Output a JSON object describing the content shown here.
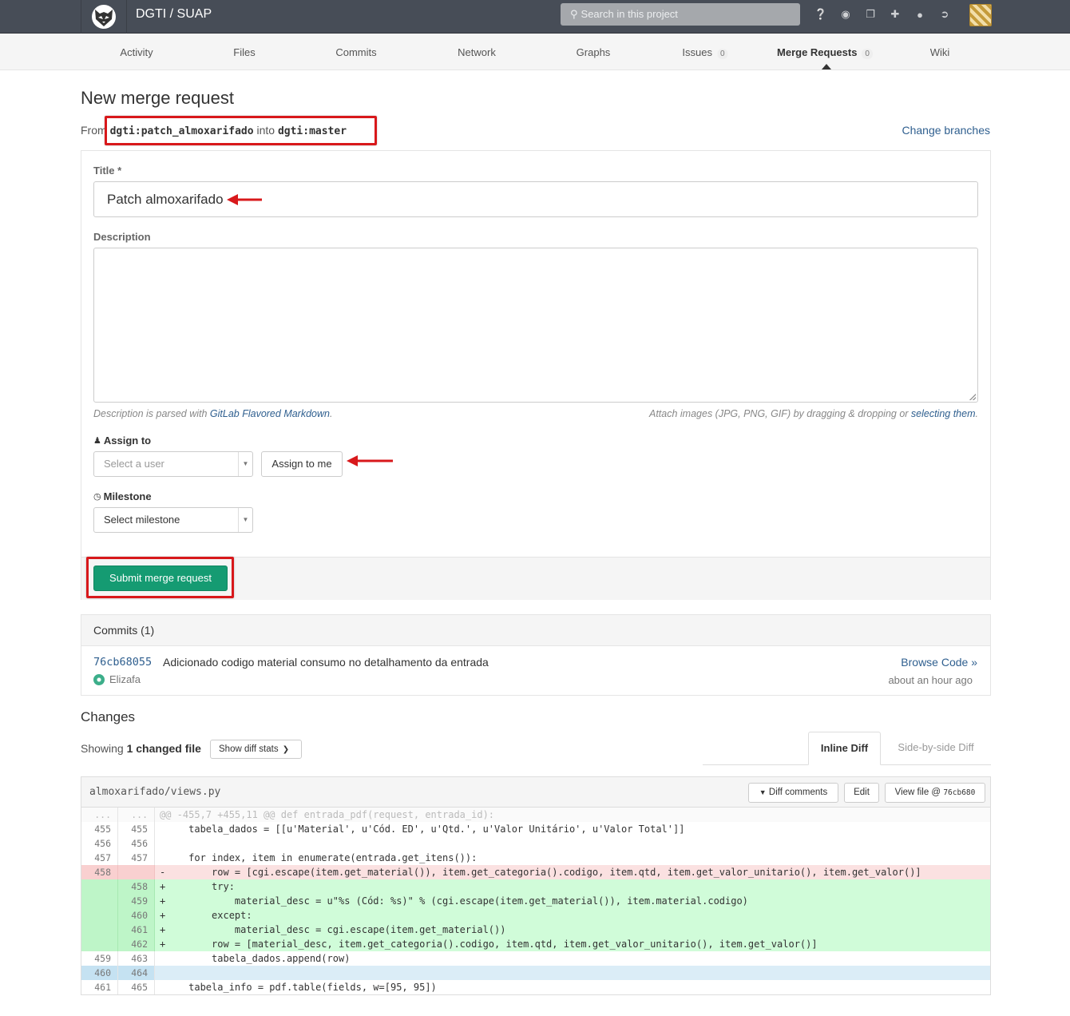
{
  "header": {
    "project_title": "DGTI / SUAP",
    "search_placeholder": "Search in this project",
    "icons": [
      "help-icon",
      "globe-icon",
      "snippets-icon",
      "plus-icon",
      "user-icon",
      "logout-icon"
    ]
  },
  "nav": {
    "tabs": [
      {
        "label": "Activity"
      },
      {
        "label": "Files"
      },
      {
        "label": "Commits"
      },
      {
        "label": "Network"
      },
      {
        "label": "Graphs"
      },
      {
        "label": "Issues",
        "badge": "0"
      },
      {
        "label": "Merge Requests",
        "badge": "0",
        "active": true
      },
      {
        "label": "Wiki"
      }
    ]
  },
  "page": {
    "title": "New merge request",
    "from_prefix": "From",
    "source_branch": "dgti:patch_almoxarifado",
    "into_word": "into",
    "target_branch": "dgti:master",
    "change_branches": "Change branches"
  },
  "form": {
    "title_label": "Title *",
    "title_value": "Patch almoxarifado",
    "description_label": "Description",
    "description_value": "",
    "hint_left_prefix": "Description is parsed with ",
    "hint_left_link": "GitLab Flavored Markdown",
    "hint_left_suffix": ".",
    "hint_right_prefix": "Attach images (JPG, PNG, GIF) by dragging & dropping or ",
    "hint_right_link": "selecting them",
    "hint_right_suffix": ".",
    "assign_label": "Assign to",
    "assign_placeholder": "Select a user",
    "assign_me": "Assign to me",
    "milestone_label": "Milestone",
    "milestone_placeholder": "Select milestone",
    "submit": "Submit merge request"
  },
  "commits": {
    "heading": "Commits (1)",
    "items": [
      {
        "sha": "76cb68055",
        "message": "Adicionado codigo material consumo no detalhamento da entrada",
        "author": "Elizafa",
        "browse": "Browse Code »",
        "time": "about an hour ago"
      }
    ]
  },
  "changes": {
    "heading": "Changes",
    "showing_prefix": "Showing ",
    "showing_count": "1 changed file",
    "diff_stats": "Show diff stats",
    "tab_inline": "Inline Diff",
    "tab_side": "Side-by-side Diff",
    "file": {
      "path": "almoxarifado/views.py",
      "diff_comments": "Diff comments",
      "edit": "Edit",
      "view_file": "View file @ ",
      "view_sha": "76cb680",
      "lines": [
        {
          "type": "hunk",
          "old": "...",
          "new": "...",
          "code": "@@ -455,7 +455,11 @@ def entrada_pdf(request, entrada_id):"
        },
        {
          "type": "ctx",
          "old": "455",
          "new": "455",
          "code": "     tabela_dados = [[u'Material', u'Cód. ED', u'Qtd.', u'Valor Unitário', u'Valor Total']]"
        },
        {
          "type": "ctx",
          "old": "456",
          "new": "456",
          "code": " "
        },
        {
          "type": "ctx",
          "old": "457",
          "new": "457",
          "code": "     for index, item in enumerate(entrada.get_itens()):"
        },
        {
          "type": "del",
          "old": "458",
          "new": "",
          "code": "-        row = [cgi.escape(item.get_material()), item.get_categoria().codigo, item.qtd, item.get_valor_unitario(), item.get_valor()]"
        },
        {
          "type": "add",
          "old": "",
          "new": "458",
          "code": "+        try:"
        },
        {
          "type": "add",
          "old": "",
          "new": "459",
          "code": "+            material_desc = u\"%s (Cód: %s)\" % (cgi.escape(item.get_material()), item.material.codigo)"
        },
        {
          "type": "add",
          "old": "",
          "new": "460",
          "code": "+        except:"
        },
        {
          "type": "add",
          "old": "",
          "new": "461",
          "code": "+            material_desc = cgi.escape(item.get_material())"
        },
        {
          "type": "add",
          "old": "",
          "new": "462",
          "code": "+        row = [material_desc, item.get_categoria().codigo, item.qtd, item.get_valor_unitario(), item.get_valor()]"
        },
        {
          "type": "ctx",
          "old": "459",
          "new": "463",
          "code": "         tabela_dados.append(row)"
        },
        {
          "type": "match",
          "old": "460",
          "new": "464",
          "code": " "
        },
        {
          "type": "ctx",
          "old": "461",
          "new": "465",
          "code": "     tabela_info = pdf.table(fields, w=[95, 95])"
        }
      ]
    }
  },
  "colors": {
    "header_bg": "#474d57",
    "submit_bg": "#159b72",
    "link": "#2f5f8f",
    "annotation_red": "#d8181b"
  }
}
